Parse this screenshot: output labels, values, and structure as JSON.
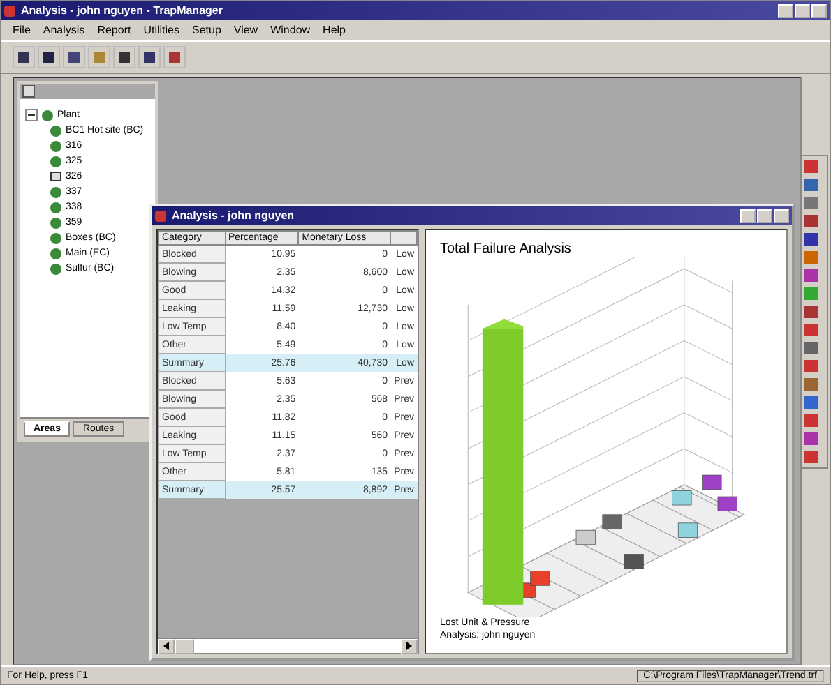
{
  "window": {
    "title": "Analysis - john nguyen - TrapManager"
  },
  "menu": [
    "File",
    "Analysis",
    "Report",
    "Utilities",
    "Setup",
    "View",
    "Window",
    "Help"
  ],
  "explorer": {
    "tree": [
      {
        "label": "Plant",
        "expanded": true,
        "children": [
          {
            "label": "BC1 Hot site (BC)",
            "kind": "trap"
          },
          {
            "label": "316",
            "kind": "trap"
          },
          {
            "label": "325",
            "kind": "trap"
          },
          {
            "label": "326",
            "kind": "device"
          },
          {
            "label": "337",
            "kind": "trap"
          },
          {
            "label": "338",
            "kind": "trap"
          },
          {
            "label": "359",
            "kind": "trap"
          },
          {
            "label": "Boxes (BC)",
            "kind": "trap"
          },
          {
            "label": "Main (EC)",
            "kind": "trap"
          },
          {
            "label": "Sulfur (BC)",
            "kind": "trap"
          }
        ]
      }
    ],
    "tabs": [
      {
        "label": "Areas",
        "selected": true
      },
      {
        "label": "Routes",
        "selected": false
      }
    ]
  },
  "analysis_window": {
    "title": "Analysis - john nguyen",
    "table": {
      "columns": [
        "Category",
        "Percentage",
        "Monetary Loss"
      ],
      "rows": [
        {
          "kind": "data",
          "cells": [
            "Blocked",
            "10.95",
            "0",
            "Low"
          ]
        },
        {
          "kind": "data",
          "cells": [
            "Blowing",
            "2.35",
            "8,600",
            "Low"
          ]
        },
        {
          "kind": "data",
          "cells": [
            "Good",
            "14.32",
            "0",
            "Low"
          ]
        },
        {
          "kind": "data",
          "cells": [
            "Leaking",
            "11.59",
            "12,730",
            "Low"
          ]
        },
        {
          "kind": "data",
          "cells": [
            "Low Temp",
            "8.40",
            "0",
            "Low"
          ]
        },
        {
          "kind": "data",
          "cells": [
            "Other",
            "5.49",
            "0",
            "Low"
          ]
        },
        {
          "kind": "summary",
          "cells": [
            "Summary",
            "25.76",
            "40,730",
            "Low"
          ]
        },
        {
          "kind": "data",
          "cells": [
            "Blocked",
            "5.63",
            "0",
            "Prev"
          ]
        },
        {
          "kind": "data",
          "cells": [
            "Blowing",
            "2.35",
            "568",
            "Prev"
          ]
        },
        {
          "kind": "data",
          "cells": [
            "Good",
            "11.82",
            "0",
            "Prev"
          ]
        },
        {
          "kind": "data",
          "cells": [
            "Leaking",
            "11.15",
            "560",
            "Prev"
          ]
        },
        {
          "kind": "data",
          "cells": [
            "Low Temp",
            "2.37",
            "0",
            "Prev"
          ]
        },
        {
          "kind": "data",
          "cells": [
            "Other",
            "5.81",
            "135",
            "Prev"
          ]
        },
        {
          "kind": "summary",
          "cells": [
            "Summary",
            "25.57",
            "8,892",
            "Prev"
          ]
        }
      ]
    },
    "chart": {
      "title": "Total Failure Analysis",
      "caption": [
        "Lost Unit & Pressure",
        "Analysis:  john nguyen"
      ]
    }
  },
  "status_bar": {
    "help": "For Help, press F1",
    "path": "C:\\Program Files\\TrapManager\\Trend.trf"
  }
}
